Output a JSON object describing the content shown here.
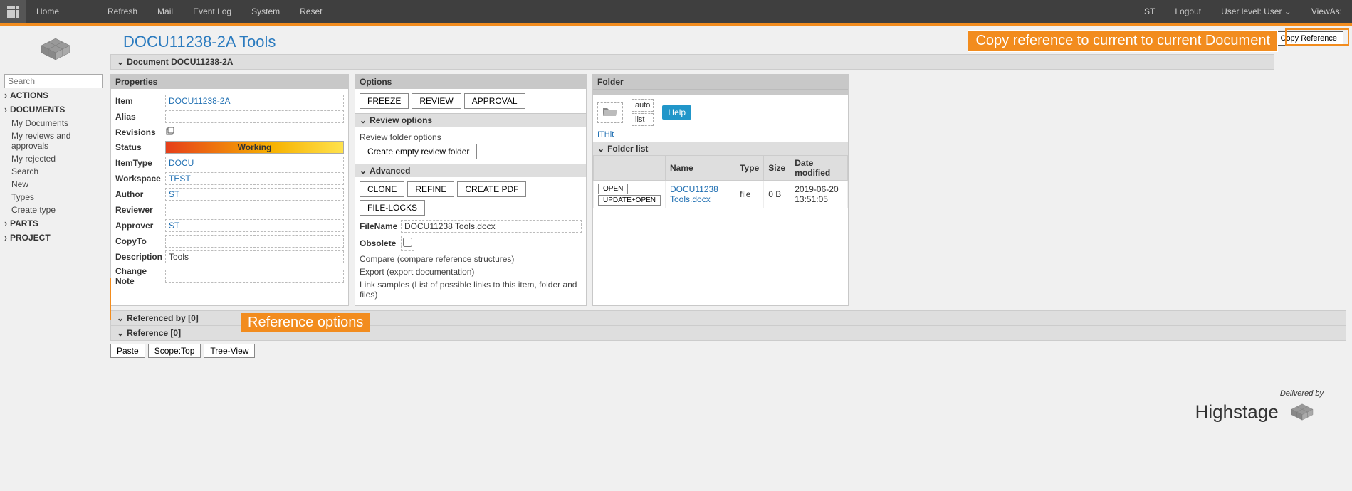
{
  "topbar": {
    "home": "Home",
    "refresh": "Refresh",
    "mail": "Mail",
    "eventlog": "Event Log",
    "system": "System",
    "reset": "Reset",
    "user_initials": "ST",
    "logout": "Logout",
    "userlevel": "User level: User",
    "viewas": "ViewAs:"
  },
  "page": {
    "title": "DOCU11238-2A Tools",
    "doc_header": "Document DOCU11238-2A",
    "copy_reference_btn": "Copy Reference"
  },
  "callouts": {
    "copy": "Copy reference to current to current Document",
    "ref": "Reference options"
  },
  "sidebar": {
    "search_placeholder": "Search",
    "actions": "ACTIONS",
    "documents": "DOCUMENTS",
    "doc_items": [
      "My Documents",
      "My reviews and approvals",
      "My rejected",
      "Search",
      "New",
      "Types",
      "Create type"
    ],
    "parts": "PARTS",
    "project": "PROJECT"
  },
  "properties": {
    "header": "Properties",
    "labels": {
      "Item": "Item",
      "Alias": "Alias",
      "Revisions": "Revisions",
      "Status": "Status",
      "ItemType": "ItemType",
      "Workspace": "Workspace",
      "Author": "Author",
      "Reviewer": "Reviewer",
      "Approver": "Approver",
      "CopyTo": "CopyTo",
      "Description": "Description",
      "ChangeNote": "Change Note"
    },
    "values": {
      "Item": "DOCU11238-2A",
      "Alias": "",
      "Status": "Working",
      "ItemType": "DOCU",
      "Workspace": "TEST",
      "Author": "ST",
      "Reviewer": "",
      "Approver": "ST",
      "CopyTo": "",
      "Description": "Tools",
      "ChangeNote": ""
    }
  },
  "options": {
    "header": "Options",
    "actions": {
      "freeze": "FREEZE",
      "review": "REVIEW",
      "approval": "APPROVAL"
    },
    "review_header": "Review options",
    "review_note": "Review folder options",
    "create_review": "Create empty review folder",
    "advanced_header": "Advanced",
    "adv_actions": {
      "clone": "CLONE",
      "refine": "REFINE",
      "createpdf": "CREATE PDF",
      "filelocks": "FILE-LOCKS"
    },
    "filename_label": "FileName",
    "filename_value": "DOCU11238 Tools.docx",
    "obsolete_label": "Obsolete",
    "links": {
      "compare": "Compare (compare reference structures)",
      "export": "Export (export documentation)",
      "linksamples": "Link samples (List of possible links to this item, folder and files)"
    }
  },
  "folder": {
    "header": "Folder",
    "auto": "auto",
    "list": "list",
    "help": "Help",
    "ithit": "ITHit",
    "folderlist": "Folder list",
    "cols": {
      "name": "Name",
      "type": "Type",
      "size": "Size",
      "modified": "Date modified"
    },
    "row_open": "OPEN",
    "row_update": "UPDATE+OPEN",
    "row": {
      "name": "DOCU11238 Tools.docx",
      "type": "file",
      "size": "0 B",
      "modified": "2019-06-20 13:51:05"
    }
  },
  "refs": {
    "refby": "Referenced by [0]",
    "reference": "Reference [0]",
    "paste": "Paste",
    "scope": "Scope:Top",
    "tree": "Tree-View"
  },
  "footer": {
    "delivered": "Delivered by",
    "brand": "Highstage"
  }
}
